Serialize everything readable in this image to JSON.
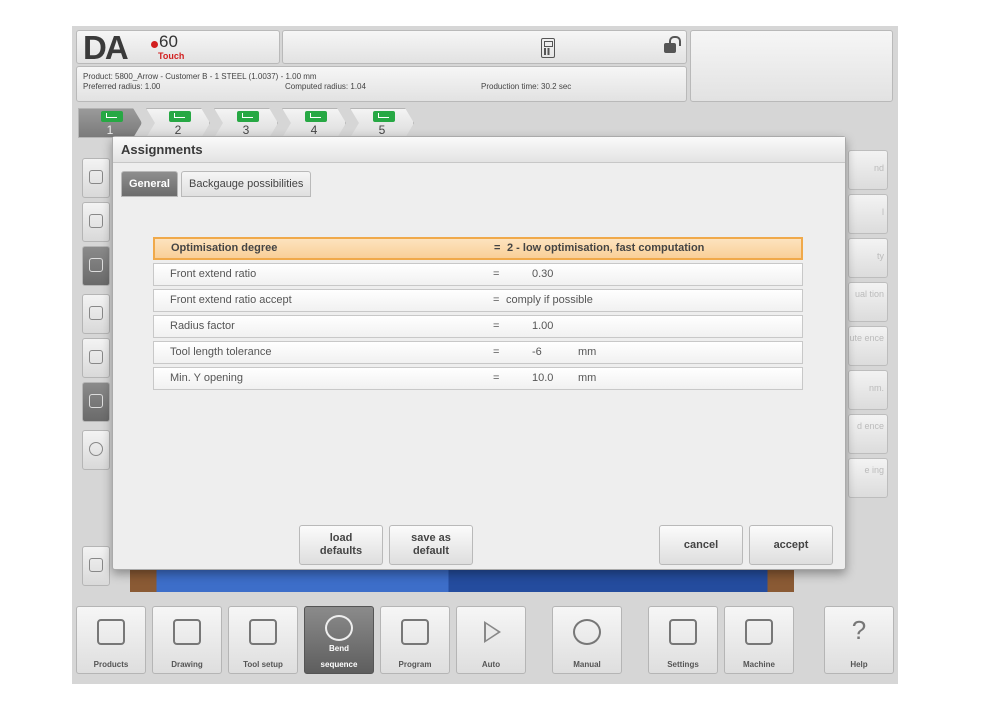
{
  "header": {
    "logo_brand": "DA",
    "logo_model": "60",
    "logo_sub": "Touch"
  },
  "info": {
    "product": "Product: 5800_Arrow - Customer B - 1 STEEL (1.0037) - 1.00 mm",
    "preferred_radius": "Preferred radius: 1.00",
    "computed_radius": "Computed radius: 1.04",
    "production_time": "Production time: 30.2 sec"
  },
  "steps": [
    {
      "label": "1",
      "status": "ok"
    },
    {
      "label": "2",
      "status": "ok"
    },
    {
      "label": "3",
      "status": "ok"
    },
    {
      "label": "4",
      "status": "ok"
    },
    {
      "label": "5",
      "status": "ok"
    }
  ],
  "right_column": [
    "nd",
    "l",
    "ty",
    "ual tion",
    "ute ence",
    "nm.",
    "d ence",
    "e ing"
  ],
  "dialog": {
    "title": "Assignments",
    "tabs": {
      "general": "General",
      "backgauge": "Backgauge possibilities"
    },
    "params": [
      {
        "label": "Optimisation degree",
        "eq": "=",
        "value": "2 - low optimisation, fast computation",
        "unit": "",
        "selected": true
      },
      {
        "label": "Front extend ratio",
        "eq": "=",
        "value": "0.30",
        "unit": "",
        "selected": false
      },
      {
        "label": "Front extend ratio accept",
        "eq": "=",
        "value": "comply if possible",
        "unit": "",
        "selected": false
      },
      {
        "label": "Radius factor",
        "eq": "=",
        "value": "1.00",
        "unit": "",
        "selected": false
      },
      {
        "label": "Tool length tolerance",
        "eq": "=",
        "value": "-6",
        "unit": "mm",
        "selected": false
      },
      {
        "label": "Min. Y opening",
        "eq": "=",
        "value": "10.0",
        "unit": "mm",
        "selected": false
      }
    ],
    "buttons": {
      "load_defaults_1": "load",
      "load_defaults_2": "defaults",
      "save_default_1": "save as",
      "save_default_2": "default",
      "cancel": "cancel",
      "accept": "accept"
    }
  },
  "nav": [
    {
      "label": "Products",
      "icon": "folder-icon"
    },
    {
      "label": "Drawing",
      "icon": "drawing-icon"
    },
    {
      "label": "Tool setup",
      "icon": "tool-setup-icon"
    },
    {
      "label": "Bend sequence",
      "sub": "Bend",
      "label2": "sequence",
      "icon": "bend-sequence-icon",
      "active": true
    },
    {
      "label": "Program",
      "icon": "program-icon"
    },
    {
      "label": "Auto",
      "icon": "play-icon"
    },
    {
      "label": "Manual",
      "icon": "hand-icon"
    },
    {
      "label": "Settings",
      "icon": "settings-icon"
    },
    {
      "label": "Machine",
      "icon": "machine-icon"
    },
    {
      "label": "Help",
      "icon": "help-icon"
    }
  ]
}
